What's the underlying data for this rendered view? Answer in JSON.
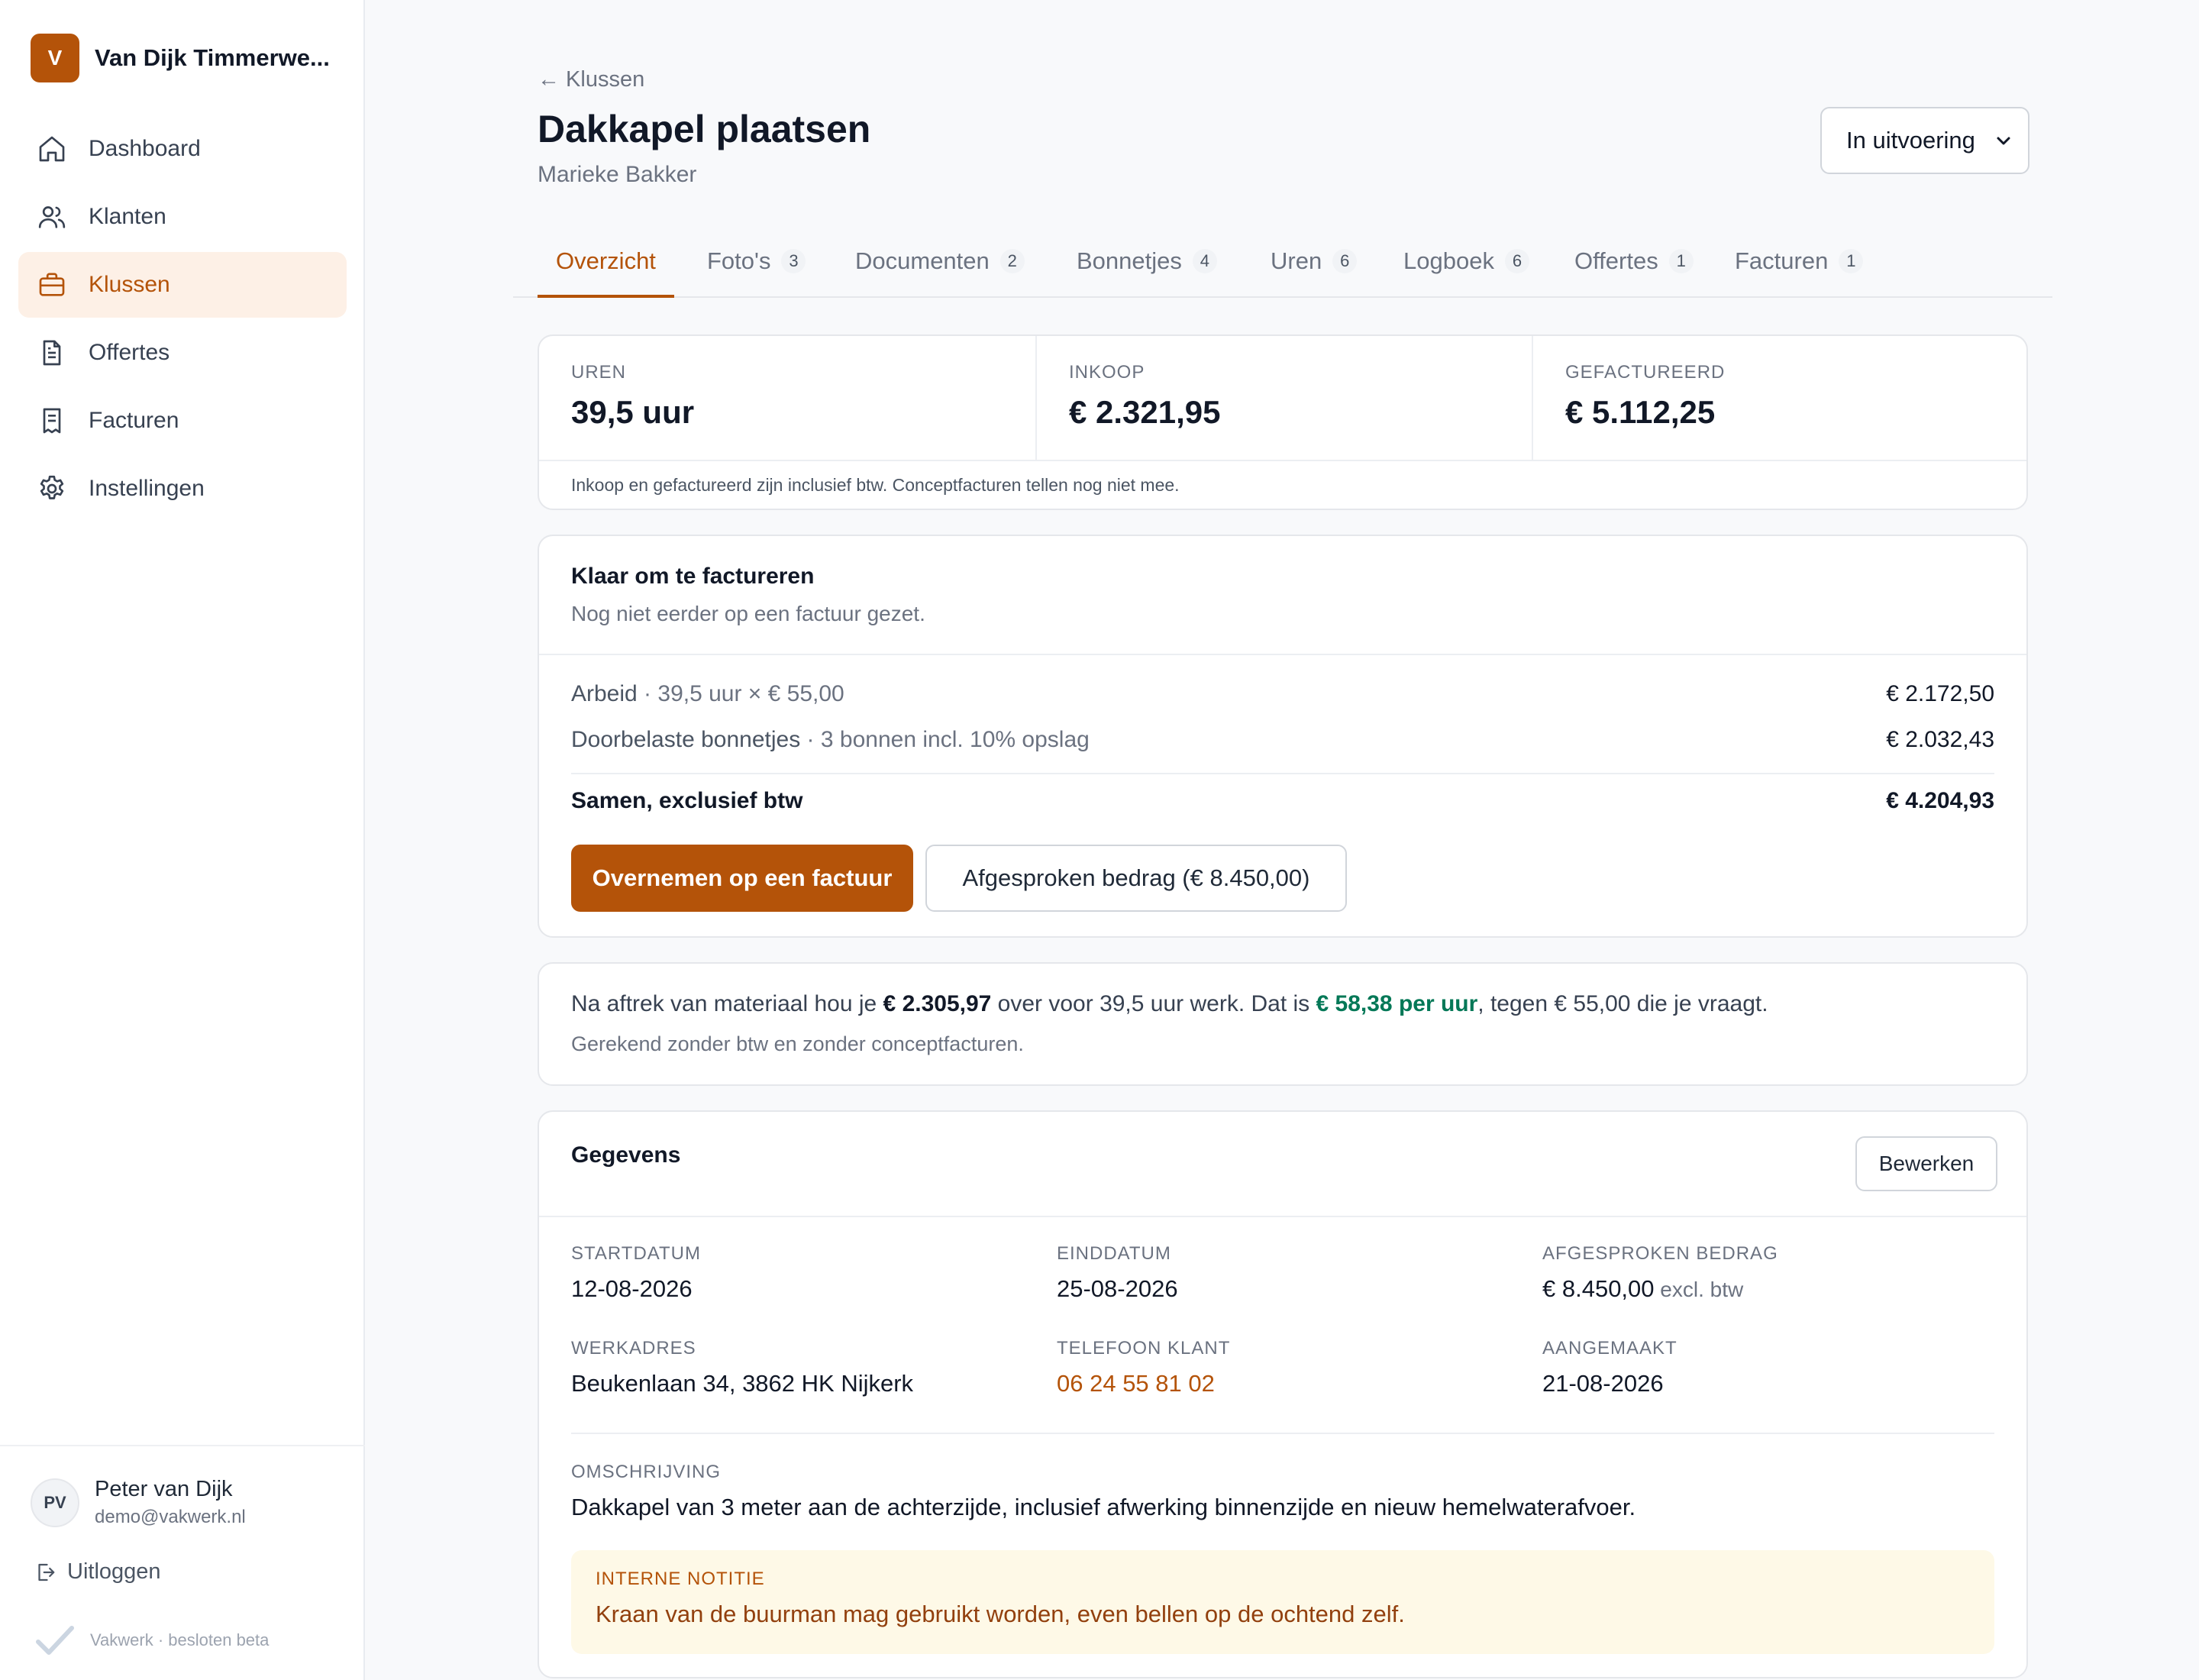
{
  "app": {
    "brand_initial": "V",
    "brand_name": "Van Dijk Timmerwe...",
    "accent_color": "#b45309"
  },
  "sidebar": {
    "items": [
      {
        "label": "Dashboard",
        "icon": "home-icon"
      },
      {
        "label": "Klanten",
        "icon": "users-icon"
      },
      {
        "label": "Klussen",
        "icon": "briefcase-icon",
        "active": true
      },
      {
        "label": "Offertes",
        "icon": "document-icon"
      },
      {
        "label": "Facturen",
        "icon": "receipt-icon"
      },
      {
        "label": "Instellingen",
        "icon": "gear-icon"
      }
    ],
    "user": {
      "initials": "PV",
      "name": "Peter van Dijk",
      "email": "demo@vakwerk.nl"
    },
    "logout_label": "Uitloggen",
    "footer": "Vakwerk · besloten beta"
  },
  "header": {
    "back_label": "← Klussen",
    "title": "Dakkapel plaatsen",
    "client": "Marieke Bakker",
    "status_value": "In uitvoering"
  },
  "tabs": [
    {
      "label": "Overzicht",
      "count": "",
      "active": true
    },
    {
      "label": "Foto's",
      "count": "3"
    },
    {
      "label": "Documenten",
      "count": "2"
    },
    {
      "label": "Bonnetjes",
      "count": "4"
    },
    {
      "label": "Uren",
      "count": "6"
    },
    {
      "label": "Logboek",
      "count": "6"
    },
    {
      "label": "Offertes",
      "count": "1"
    },
    {
      "label": "Facturen",
      "count": "1"
    }
  ],
  "stats": {
    "items": [
      {
        "label": "UREN",
        "value": "39,5 uur"
      },
      {
        "label": "INKOOP",
        "value": "€ 2.321,95"
      },
      {
        "label": "GEFACTUREERD",
        "value": "€ 5.112,25"
      }
    ],
    "note": "Inkoop en gefactureerd zijn inclusief btw. Conceptfacturen tellen nog niet mee."
  },
  "ready": {
    "title": "Klaar om te factureren",
    "subtitle": "Nog niet eerder op een factuur gezet.",
    "lines": [
      {
        "label": "Arbeid",
        "detail": " · 39,5 uur × € 55,00",
        "amount": "€ 2.172,50"
      },
      {
        "label": "Doorbelaste bonnetjes",
        "detail": " · 3 bonnen incl. 10% opslag",
        "amount": "€ 2.032,43"
      }
    ],
    "total_label": "Samen, exclusief btw",
    "total_amount": "€ 4.204,93",
    "primary_button": "Overnemen op een factuur",
    "secondary_button": "Afgesproken bedrag (€ 8.450,00)"
  },
  "margin": {
    "text_1": "Na aftrek van materiaal hou je ",
    "amount": "€ 2.305,97",
    "text_2": " over voor 39,5 uur werk. Dat is ",
    "rate": "€ 58,38 per uur",
    "text_3": ", tegen € 55,00 die je vraagt.",
    "note": "Gerekend zonder btw en zonder conceptfacturen.",
    "positive_color": "#047857"
  },
  "details": {
    "title": "Gegevens",
    "edit_button": "Bewerken",
    "fields": {
      "start": {
        "label": "STARTDATUM",
        "value": "12-08-2026"
      },
      "end": {
        "label": "EINDDATUM",
        "value": "25-08-2026"
      },
      "agreed": {
        "label": "AFGESPROKEN BEDRAG",
        "value": "€ 8.450,00",
        "suffix": " excl. btw"
      },
      "address": {
        "label": "WERKADRES",
        "value": "Beukenlaan 34, 3862 HK Nijkerk"
      },
      "phone": {
        "label": "TELEFOON KLANT",
        "value": "06 24 55 81 02"
      },
      "created": {
        "label": "AANGEMAAKT",
        "value": "21-08-2026"
      },
      "description": {
        "label": "OMSCHRIJVING",
        "value": "Dakkapel van 3 meter aan de achterzijde, inclusief afwerking binnenzijde en nieuw hemelwaterafvoer."
      }
    },
    "internal_note": {
      "label": "INTERNE NOTITIE",
      "text": "Kraan van de buurman mag gebruikt worden, even bellen op de ochtend zelf."
    }
  }
}
